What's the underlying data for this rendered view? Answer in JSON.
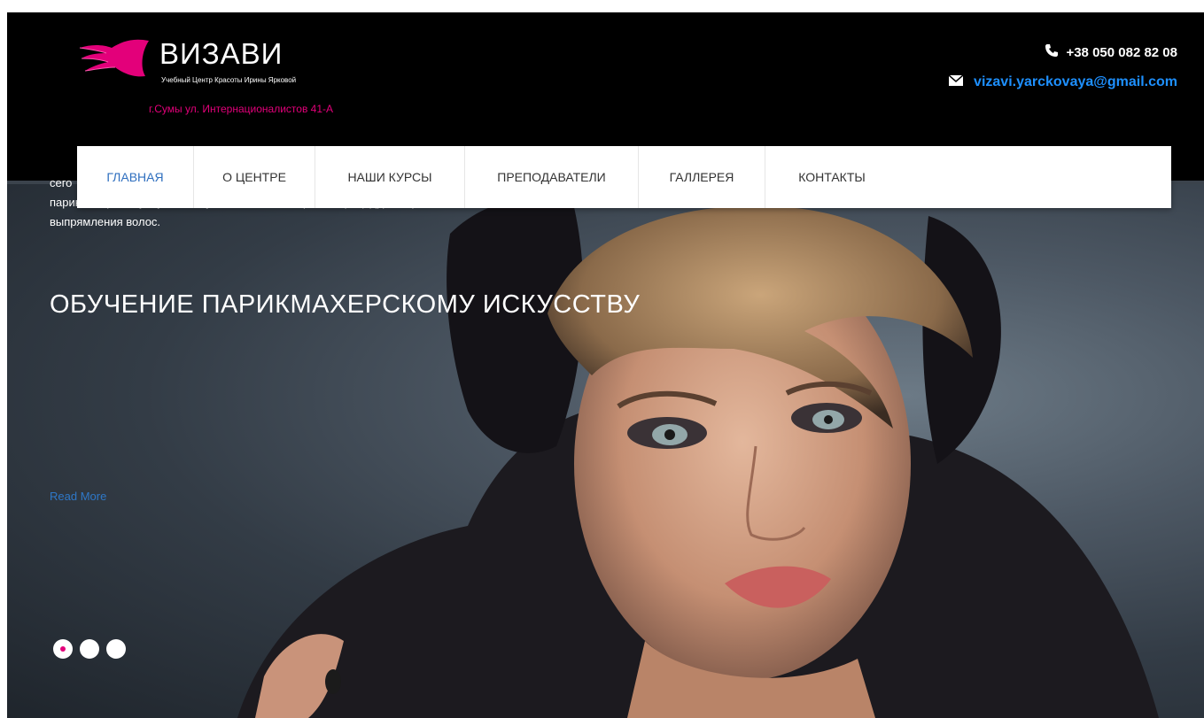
{
  "brand": {
    "name": "ВИЗАВИ",
    "subtitle": "Учебный Центр Красоты Ирины Ярковой",
    "address": "г.Сумы ул. Интернационалистов 41-А",
    "accent_color": "#e3007a"
  },
  "contact": {
    "phone": "+38 050 082 82 08",
    "email": "vizavi.yarckovaya@gmail.com",
    "phone_icon": "phone-icon",
    "email_icon": "envelope-icon"
  },
  "nav": {
    "items": [
      {
        "label": "ГЛАВНАЯ",
        "active": true
      },
      {
        "label": "О ЦЕНТРЕ"
      },
      {
        "label": "НАШИ КУРСЫ"
      },
      {
        "label": "ПРЕПОДАВАТЕЛИ"
      },
      {
        "label": "ГАЛЛЕРЕЯ"
      },
      {
        "label": "КОНТАКТЫ"
      }
    ]
  },
  "hero": {
    "text_line1": "сего",
    "text_line2": "парикмахерских услуг. Мы научим вас всем секретам процедуры кератинового лечения и",
    "text_line3": "выпрямления волос.",
    "title": "ОБУЧЕНИЕ ПАРИКМАХЕРСКОМУ ИСКУССТВУ",
    "read_more": "Read More",
    "slide_count": 3,
    "active_slide": 1
  }
}
